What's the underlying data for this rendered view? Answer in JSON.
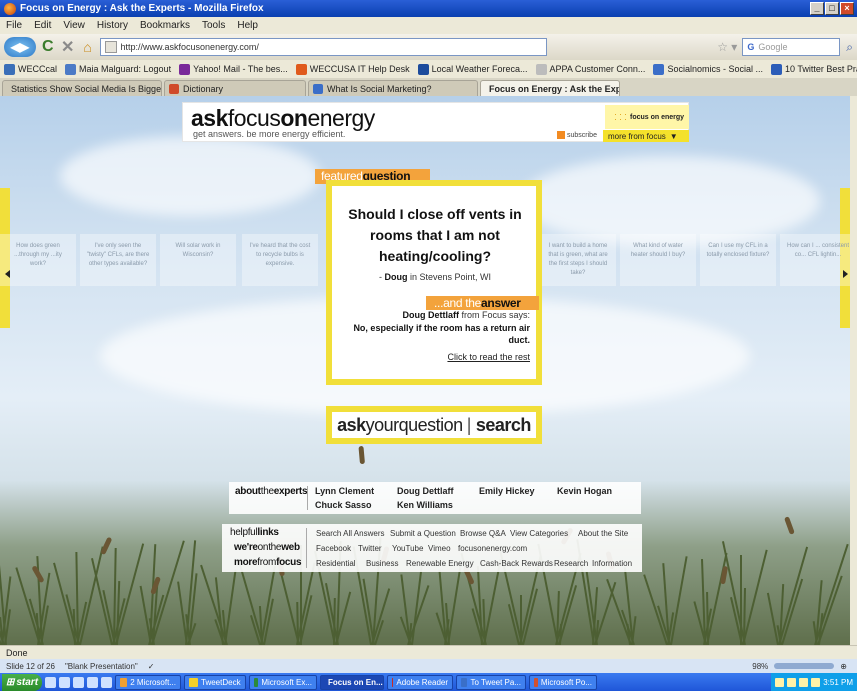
{
  "window": {
    "title": "Focus on Energy : Ask the Experts - Mozilla Firefox"
  },
  "menu": [
    "File",
    "Edit",
    "View",
    "History",
    "Bookmarks",
    "Tools",
    "Help"
  ],
  "nav": {
    "url": "http://www.askfocusonenergy.com/",
    "search_placeholder": "Google"
  },
  "bookmarks": [
    {
      "label": "WECCcal",
      "color": "#3a6fb8"
    },
    {
      "label": "Maia Malguard: Logout",
      "color": "#4b7ac6"
    },
    {
      "label": "Yahoo! Mail - The bes...",
      "color": "#7a2a9a"
    },
    {
      "label": "WECCUSA IT Help Desk",
      "color": "#e05a1c"
    },
    {
      "label": "Local Weather Foreca...",
      "color": "#1c4b9c"
    },
    {
      "label": "APPA Customer Conn...",
      "color": "#bcbcbc"
    },
    {
      "label": "Socialnomics - Social ...",
      "color": "#3b6ec8"
    },
    {
      "label": "10 Twitter Best Practi...",
      "color": "#2c5db8"
    }
  ],
  "tabs": [
    {
      "label": "Statistics Show Social Media Is Bigger T...",
      "active": false,
      "color": "#4b88d6"
    },
    {
      "label": "Dictionary",
      "active": false,
      "color": "#d04a2a"
    },
    {
      "label": "What Is Social Marketing?",
      "active": false,
      "color": "#3b6ec8"
    },
    {
      "label": "Focus on Energy : Ask the Experts",
      "active": true,
      "color": "#e8c43a"
    }
  ],
  "site": {
    "logo": {
      "part1": "ask",
      "part2": "focus",
      "part3": "on",
      "part4": "energy"
    },
    "tagline": "get answers. be more energy efficient.",
    "brand": "focus on energy",
    "subscribe": "subscribe",
    "more_from_focus": "more from focus"
  },
  "featured": {
    "label_light": "featured",
    "label_bold": "question",
    "question": "Should I close off vents in rooms that I am not heating/cooling?",
    "asker_name": "Doug",
    "asker_location": "in Stevens Point, WI",
    "answer_label_light": "...and the",
    "answer_label_bold": "answer",
    "answerer_name": "Doug Dettlaff",
    "answerer_suffix": "from Focus says:",
    "answer": "No, especially if the room has a return air duct.",
    "read_more": "Click to read the rest"
  },
  "carousel": [
    "How does green ...through my ...ity work?",
    "I've only seen the \"twisty\" CFLs, are there other types available?",
    "Will solar work in Wisconsin?",
    "I've heard that the cost to recycle bulbs is expensive.",
    "I want to build a home that is green, what are the first steps I should take?",
    "What kind of water heater should I buy?",
    "Can I use my CFL in a totally enclosed fixture?",
    "How can I ... consistent co... CFL lightin..."
  ],
  "ask": {
    "ask": "ask",
    "your_question": "yourquestion",
    "separator": "|",
    "search": "search"
  },
  "footer": {
    "about_light": "about",
    "about_mid": "the",
    "about_bold": "experts",
    "experts": [
      "Lynn Clement",
      "Doug Dettlaff",
      "Emily Hickey",
      "Kevin Hogan",
      "Chuck Sasso",
      "Ken Williams"
    ],
    "helpful_light": "helpful",
    "helpful_bold": "links",
    "helpful_links": [
      "Search All Answers",
      "Submit a Question",
      "Browse Q&A",
      "View Categories",
      "About the Site"
    ],
    "web_bold1": "we're",
    "web_light": "onthe",
    "web_bold2": "web",
    "web_links": [
      "Facebook",
      "Twitter",
      "YouTube",
      "Vimeo",
      "focusonenergy.com"
    ],
    "more_bold": "more",
    "more_light": "from",
    "more_bold2": "focus",
    "more_links": [
      "Residential",
      "Business",
      "Renewable Energy",
      "Cash-Back Rewards",
      "Research",
      "Information"
    ]
  },
  "status": {
    "text": "Done"
  },
  "ppt_status": {
    "slide": "Slide 12 of 26",
    "theme": "\"Blank Presentation\"",
    "zoom": "98%"
  },
  "taskbar": {
    "start": "start",
    "tasks": [
      {
        "label": "2 Microsoft...",
        "color": "#f0a030",
        "active": false
      },
      {
        "label": "TweetDeck",
        "color": "#f4d02a",
        "active": false
      },
      {
        "label": "Microsoft Ex...",
        "color": "#2b8a3a",
        "active": false
      },
      {
        "label": "Focus on En...",
        "color": "#e2781c",
        "active": true
      },
      {
        "label": "Adobe Reader",
        "color": "#c92a22",
        "active": false
      },
      {
        "label": "To Tweet Pa...",
        "color": "#3a6fc8",
        "active": false
      },
      {
        "label": "Microsoft Po...",
        "color": "#d2502a",
        "active": false
      }
    ],
    "clock": "3:51 PM"
  }
}
